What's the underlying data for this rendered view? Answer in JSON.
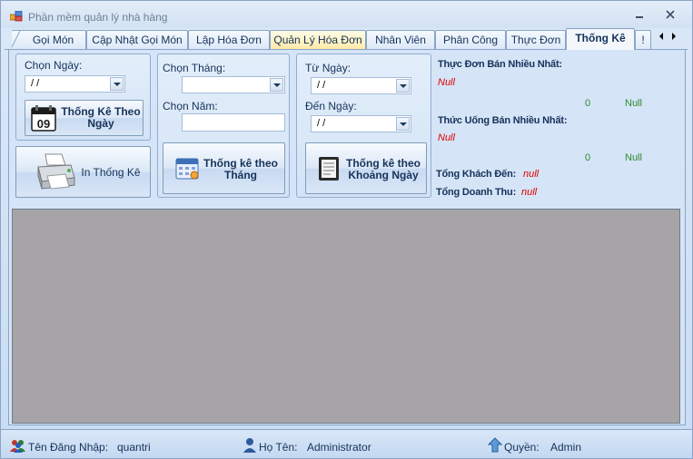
{
  "window": {
    "title": "Phần mềm quản lý nhà hàng"
  },
  "tabs": [
    {
      "label": "Gọi Món"
    },
    {
      "label": "Cập Nhật Gọi Món"
    },
    {
      "label": "Lập Hóa Đơn"
    },
    {
      "label": "Quản Lý Hóa Đơn"
    },
    {
      "label": "Nhân Viên"
    },
    {
      "label": "Phân Công"
    },
    {
      "label": "Thực Đơn"
    },
    {
      "label": "Thống Kê"
    },
    {
      "label": "!"
    }
  ],
  "by_day": {
    "label": "Chọn Ngày:",
    "date_value": " /  /",
    "button_label": "Thống Kê Theo Ngày",
    "calendar_day": "09"
  },
  "print": {
    "button_label": "In Thống Kê"
  },
  "by_month": {
    "month_label": "Chọn Tháng:",
    "year_label": "Chọn Năm:",
    "year_value": "",
    "button_label": "Thống kê theo Tháng"
  },
  "by_range": {
    "from_label": "Từ Ngày:",
    "from_value": " /  /",
    "to_label": "Đến Ngày:",
    "to_value": " /  /",
    "button_label": "Thống kê theo Khoảng Ngày"
  },
  "stats": {
    "best_menu_label": "Thực Đơn Bán Nhiều Nhất:",
    "best_menu_value": "Null",
    "best_menu_count": "0",
    "best_menu_extra": "Null",
    "best_drink_label": "Thức Uống Bán Nhiều Nhất:",
    "best_drink_value": "Null",
    "best_drink_count": "0",
    "best_drink_extra": "Null",
    "total_customers_label": "Tổng Khách Đến:",
    "total_customers_value": "null",
    "total_revenue_label": "Tổng Doanh Thu:",
    "total_revenue_value": "null"
  },
  "status": {
    "username_label": "Tên Đăng Nhập:",
    "username_value": "quantri",
    "fullname_label": "Họ Tên:",
    "fullname_value": "Administrator",
    "role_label": "Quyền:",
    "role_value": "Admin"
  },
  "colors": {
    "null_red": "#e00000",
    "count_green": "#2e8b2e",
    "grid_gray": "#a6a4a6"
  }
}
